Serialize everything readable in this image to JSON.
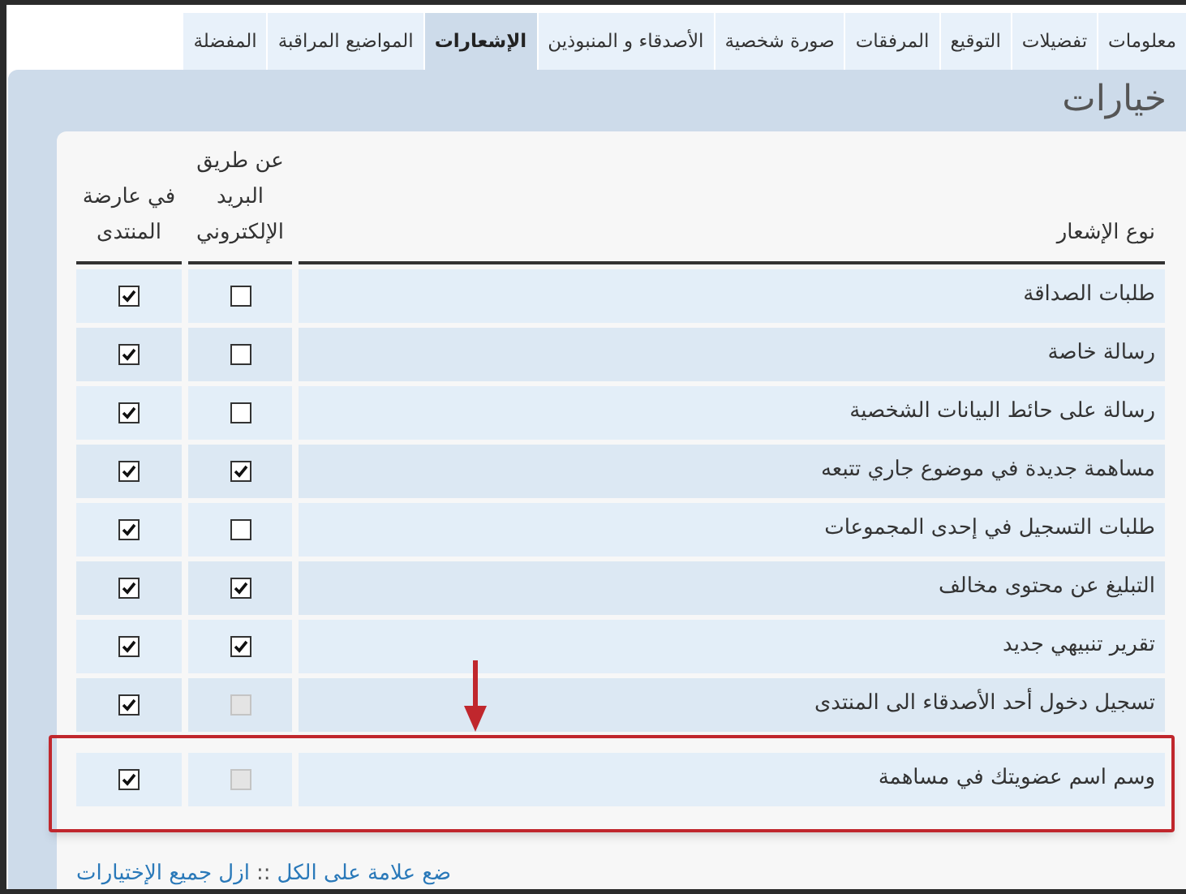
{
  "tabs": [
    {
      "label": "معلومات",
      "selected": false
    },
    {
      "label": "تفضيلات",
      "selected": false
    },
    {
      "label": "التوقيع",
      "selected": false
    },
    {
      "label": "المرفقات",
      "selected": false
    },
    {
      "label": "صورة شخصية",
      "selected": false
    },
    {
      "label": "الأصدقاء و المنبوذين",
      "selected": false
    },
    {
      "label": "الإشعارات",
      "selected": true
    },
    {
      "label": "المواضيع المراقبة",
      "selected": false
    },
    {
      "label": "المفضلة",
      "selected": false
    }
  ],
  "panel_title": "خيارات",
  "table": {
    "columns": [
      "نوع الإشعار",
      "عن طريق البريد الإلكتروني",
      "في عارضة المنتدى"
    ],
    "rows": [
      {
        "label": "طلبات الصداقة",
        "email": {
          "checked": false,
          "disabled": false
        },
        "forum": {
          "checked": true,
          "disabled": false
        },
        "highlighted": false
      },
      {
        "label": "رسالة خاصة",
        "email": {
          "checked": false,
          "disabled": false
        },
        "forum": {
          "checked": true,
          "disabled": false
        },
        "highlighted": false
      },
      {
        "label": "رسالة على حائط البيانات الشخصية",
        "email": {
          "checked": false,
          "disabled": false
        },
        "forum": {
          "checked": true,
          "disabled": false
        },
        "highlighted": false
      },
      {
        "label": "مساهمة جديدة في موضوع جاري تتبعه",
        "email": {
          "checked": true,
          "disabled": false
        },
        "forum": {
          "checked": true,
          "disabled": false
        },
        "highlighted": false
      },
      {
        "label": "طلبات التسجيل في إحدى المجموعات",
        "email": {
          "checked": false,
          "disabled": false
        },
        "forum": {
          "checked": true,
          "disabled": false
        },
        "highlighted": false
      },
      {
        "label": "التبليغ عن محتوى مخالف",
        "email": {
          "checked": true,
          "disabled": false
        },
        "forum": {
          "checked": true,
          "disabled": false
        },
        "highlighted": false
      },
      {
        "label": "تقرير تنبيهي جديد",
        "email": {
          "checked": true,
          "disabled": false
        },
        "forum": {
          "checked": true,
          "disabled": false
        },
        "highlighted": false
      },
      {
        "label": "تسجيل دخول أحد الأصدقاء الى المنتدى",
        "email": {
          "checked": false,
          "disabled": true
        },
        "forum": {
          "checked": true,
          "disabled": false
        },
        "highlighted": false
      },
      {
        "label": "وسم اسم عضويتك في مساهمة",
        "email": {
          "checked": false,
          "disabled": true
        },
        "forum": {
          "checked": true,
          "disabled": false
        },
        "highlighted": true
      }
    ]
  },
  "footer": {
    "check_all": "ضع علامة على الكل",
    "separator": "::",
    "clear_all": "ازل جميع الإختيارات"
  }
}
